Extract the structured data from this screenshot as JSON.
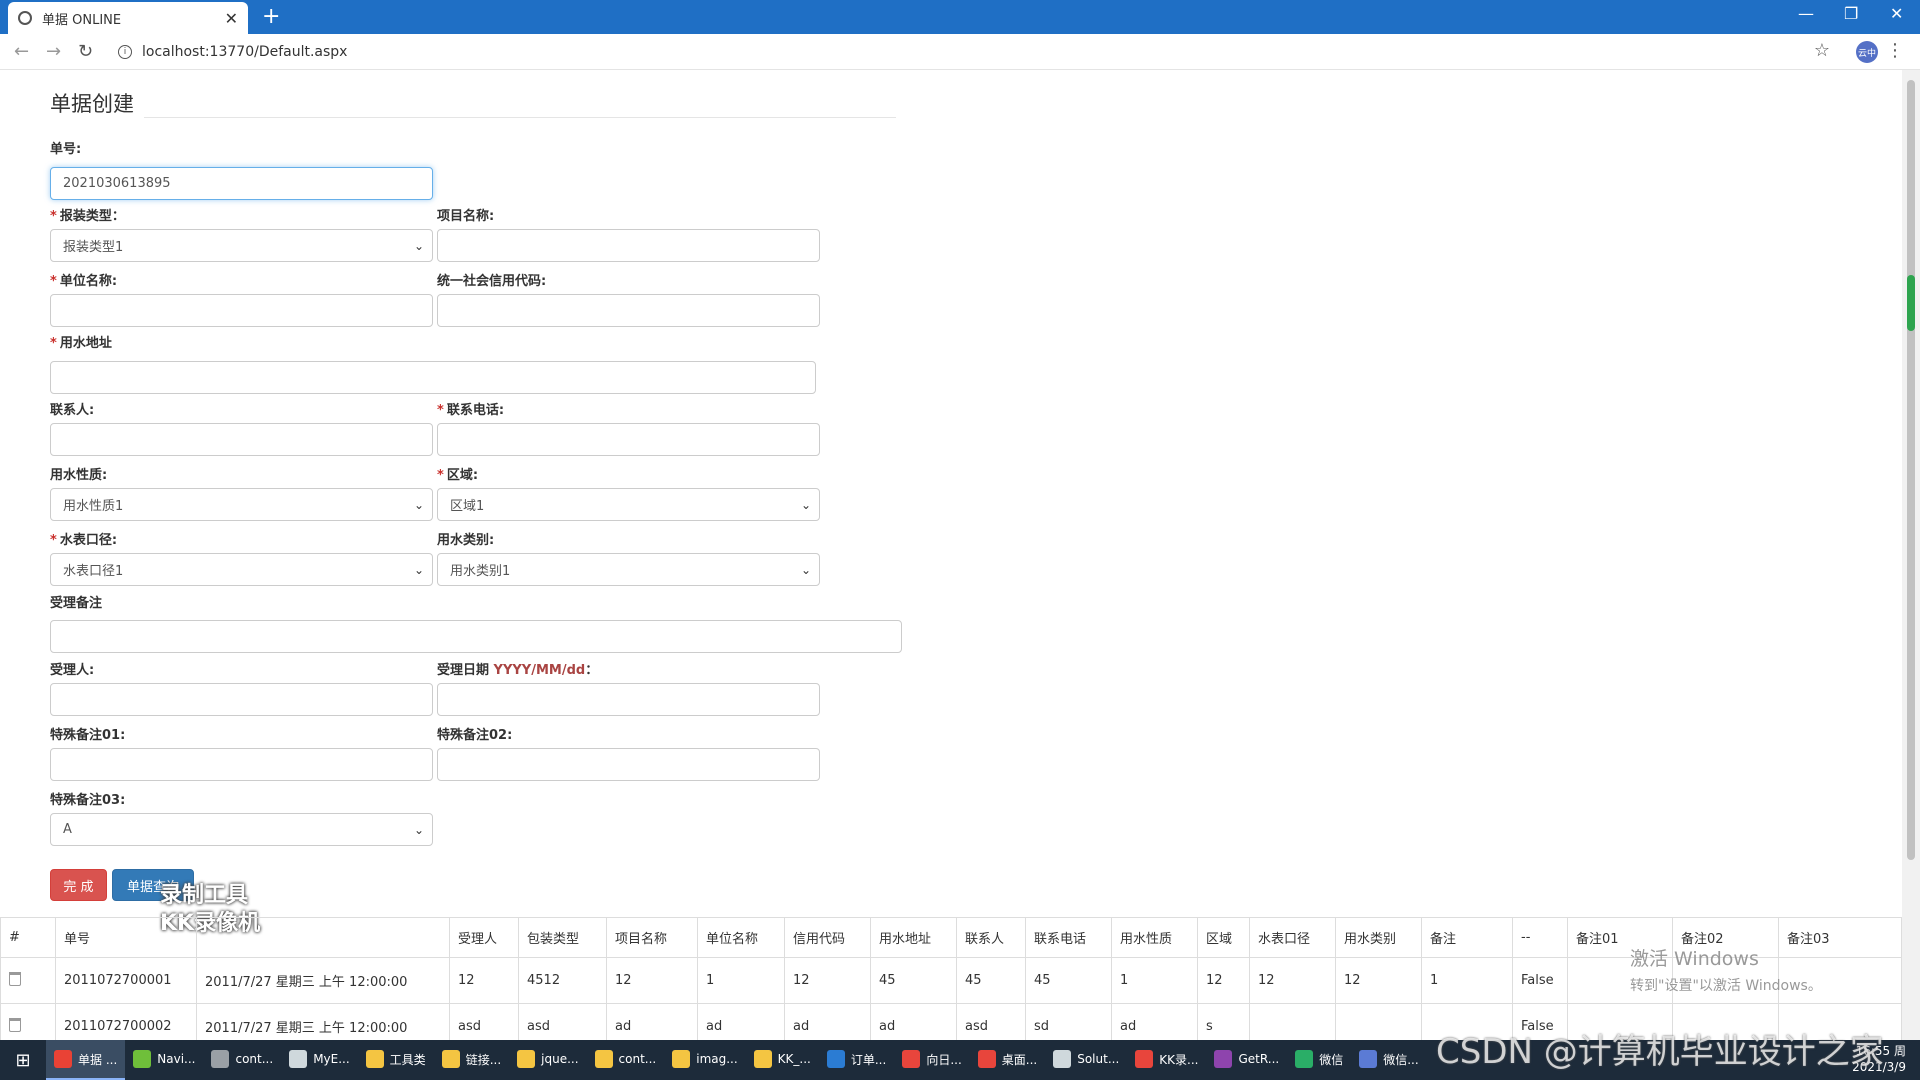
{
  "browser": {
    "tab_title": "单据 ONLINE",
    "tab_close": "✕",
    "new_tab": "+",
    "url": "localhost:13770/Default.aspx",
    "profile": "云中"
  },
  "form": {
    "title": "单据创建",
    "order_no_label": "单号:",
    "order_no_value": "2021030613895",
    "pack_type_label": "报装类型：",
    "pack_type_value": "报装类型1",
    "project_label": "项目名称:",
    "unit_label": "单位名称:",
    "credit_label": "统一社会信用代码:",
    "address_label": "用水地址",
    "contact_label": "联系人:",
    "phone_label": "联系电话:",
    "water_nature_label": "用水性质:",
    "water_nature_value": "用水性质1",
    "area_label": "区域:",
    "area_value": "区域1",
    "meter_label": "水表口径:",
    "meter_value": "水表口径1",
    "water_type_label": "用水类别:",
    "water_type_value": "用水类别1",
    "remark_label": "受理备注",
    "handler_label": "受理人:",
    "date_label": "受理日期",
    "date_hint": "YYYY/MM/dd",
    "date_colon": "：",
    "special01_label": "特殊备注01:",
    "special02_label": "特殊备注02:",
    "special03_label": "特殊备注03:",
    "special03_value": "A",
    "required_mark": "*",
    "submit_label": "完 成",
    "query_label": "单据查询"
  },
  "recorder_watermark": [
    "录制工具",
    "KK录像机"
  ],
  "table": {
    "headers": [
      "#",
      "单号",
      "",
      "受理人",
      "包装类型",
      "项目名称",
      "单位名称",
      "信用代码",
      "用水地址",
      "联系人",
      "联系电话",
      "用水性质",
      "区域",
      "水表口径",
      "用水类别",
      "备注",
      "--",
      "备注01",
      "备注02",
      "备注03"
    ],
    "rows": [
      [
        "2011072700001",
        "2011/7/27 星期三 上午 12:00:00",
        "12",
        "4512",
        "12",
        "1",
        "12",
        "45",
        "45",
        "45",
        "1",
        "12",
        "12",
        "12",
        "1",
        "False",
        "",
        "",
        ""
      ],
      [
        "2011072700002",
        "2011/7/27 星期三 上午 12:00:00",
        "asd",
        "asd",
        "ad",
        "ad",
        "ad",
        "ad",
        "asd",
        "sd",
        "ad",
        "s",
        "",
        "",
        "",
        "False",
        "",
        "",
        ""
      ]
    ]
  },
  "overlay": {
    "activate_title": "激活 Windows",
    "activate_sub": "转到\"设置\"以激活 Windows。",
    "csdn": "CSDN @计算机毕业设计之家"
  },
  "taskbar": {
    "items": [
      {
        "label": "单据 ...",
        "color": "#e94235"
      },
      {
        "label": "Navi...",
        "color": "#6fbf3a"
      },
      {
        "label": "cont...",
        "color": "#9aa0a6"
      },
      {
        "label": "MyE...",
        "color": "#cfd8dc"
      },
      {
        "label": "工具类",
        "color": "#f4c542"
      },
      {
        "label": "链接...",
        "color": "#f4c542"
      },
      {
        "label": "jque...",
        "color": "#f4c542"
      },
      {
        "label": "cont...",
        "color": "#f4c542"
      },
      {
        "label": "imag...",
        "color": "#f4c542"
      },
      {
        "label": "KK_...",
        "color": "#f4c542"
      },
      {
        "label": "订单...",
        "color": "#2b7cd3"
      },
      {
        "label": "向日...",
        "color": "#e8453c"
      },
      {
        "label": "桌面...",
        "color": "#e8453c"
      },
      {
        "label": "Solut...",
        "color": "#cfd8dc"
      },
      {
        "label": "KK录...",
        "color": "#e8453c"
      },
      {
        "label": "GetR...",
        "color": "#8e44ad"
      },
      {
        "label": "微信",
        "color": "#2aae67"
      },
      {
        "label": "微信...",
        "color": "#5b7bd5"
      }
    ],
    "time": "16:55 周",
    "date": "2021/3/9"
  }
}
